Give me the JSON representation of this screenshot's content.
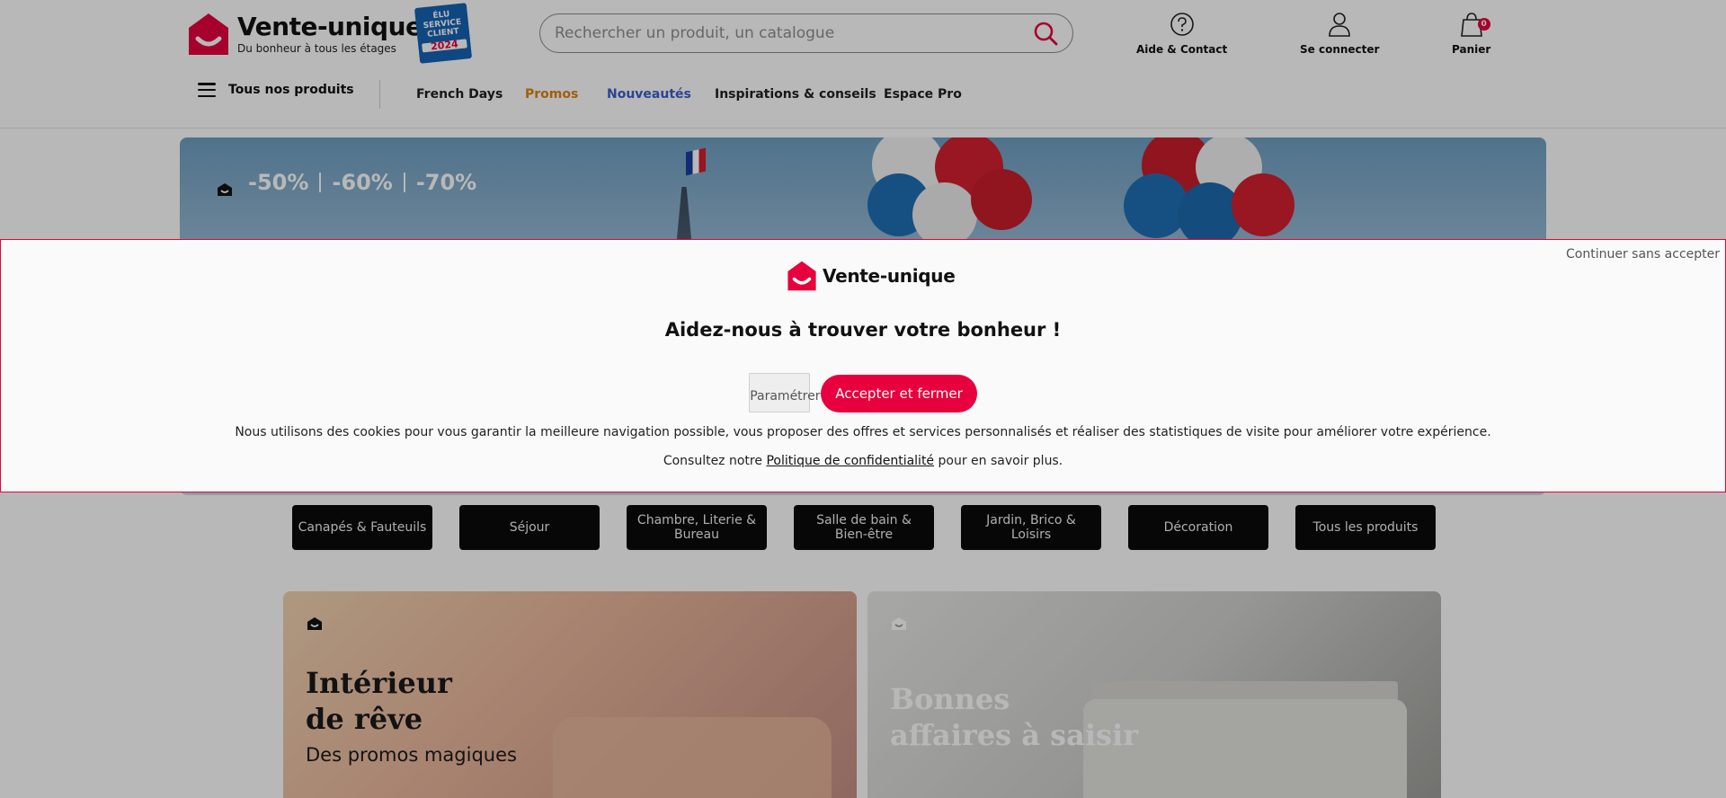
{
  "header": {
    "logo_name": "Vente-unique",
    "logo_tagline": "Du bonheur à tous les étages",
    "award_label": "ÉLU SERVICE CLIENT",
    "award_year": "2024",
    "search_placeholder": "Rechercher un produit, un catalogue",
    "help_label": "Aide & Contact",
    "login_label": "Se connecter",
    "cart_label": "Panier",
    "cart_count": "0"
  },
  "nav": {
    "all_products": "Tous nos produits",
    "items": [
      "French Days",
      "Promos",
      "Nouveautés",
      "Inspirations & conseils",
      "Espace Pro"
    ],
    "colors": {
      "promos": "#e0830e",
      "nouveautes": "#3a5fcd",
      "default": "#222222"
    }
  },
  "hero": {
    "promos": [
      "-50%",
      "-60%",
      "-70%"
    ]
  },
  "categories": [
    "Canapés & Fauteuils",
    "Séjour",
    "Chambre, Literie & Bureau",
    "Salle de bain & Bien-être",
    "Jardin, Brico & Loisirs",
    "Décoration",
    "Tous les produits"
  ],
  "cards": [
    {
      "title_l1": "Intérieur",
      "title_l2": "de rêve",
      "subtitle": "Des promos magiques"
    },
    {
      "title_l1": "Bonnes",
      "title_l2": "affaires à saisir"
    }
  ],
  "cookie": {
    "skip": "Continuer sans accepter",
    "logo_name": "Vente-unique",
    "title": "Aidez-nous à trouver votre bonheur !",
    "param_button": "Paramétrer",
    "accept_button": "Accepter et fermer",
    "text": "Nous utilisons des cookies pour vous garantir la meilleure navigation possible, vous proposer des offres et services personnalisés et réaliser des statistiques de visite pour améliorer votre expérience.",
    "text2_before": "Consultez notre",
    "text2_link": "Politique de confidentialité",
    "text2_after": "pour en savoir plus."
  },
  "colors": {
    "brand": "#e7003d",
    "dark": "#0b0b0b"
  }
}
